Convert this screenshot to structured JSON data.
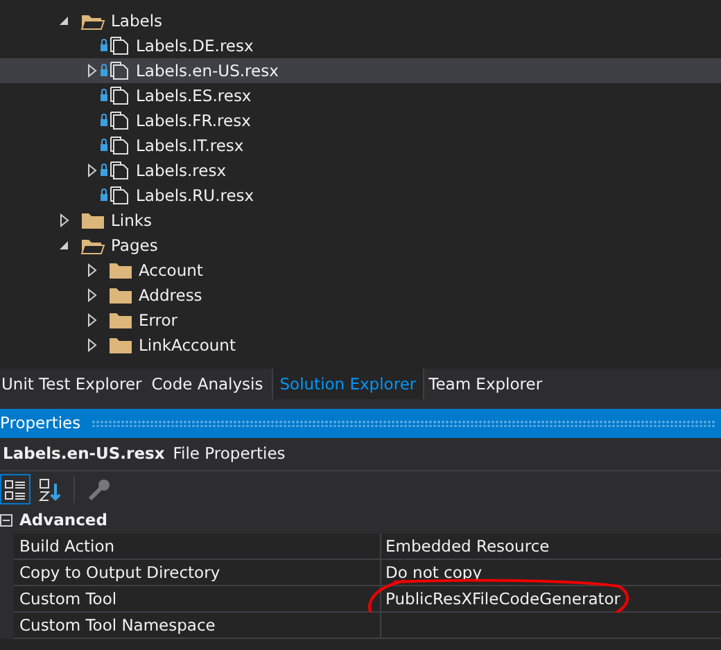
{
  "solution_tree": [
    {
      "label": "Labels",
      "kind": "folder",
      "expanded": true,
      "selected": false,
      "children": [
        {
          "label": "Labels.DE.resx",
          "kind": "file",
          "selected": false
        },
        {
          "label": "Labels.en-US.resx",
          "kind": "file",
          "expanded": false,
          "selected": true
        },
        {
          "label": "Labels.ES.resx",
          "kind": "file",
          "selected": false
        },
        {
          "label": "Labels.FR.resx",
          "kind": "file",
          "selected": false
        },
        {
          "label": "Labels.IT.resx",
          "kind": "file",
          "selected": false
        },
        {
          "label": "Labels.resx",
          "kind": "file",
          "expanded": false,
          "selected": false
        },
        {
          "label": "Labels.RU.resx",
          "kind": "file",
          "selected": false
        }
      ]
    },
    {
      "label": "Links",
      "kind": "folder",
      "expanded": false,
      "selected": false
    },
    {
      "label": "Pages",
      "kind": "folder",
      "expanded": true,
      "selected": false,
      "children": [
        {
          "label": "Account",
          "kind": "folder",
          "expanded": false,
          "selected": false
        },
        {
          "label": "Address",
          "kind": "folder",
          "expanded": false,
          "selected": false
        },
        {
          "label": "Error",
          "kind": "folder",
          "expanded": false,
          "selected": false
        },
        {
          "label": "LinkAccount",
          "kind": "folder",
          "expanded": false,
          "selected": false
        }
      ]
    }
  ],
  "tabs": [
    {
      "label": "Unit Test Explorer",
      "selected": false
    },
    {
      "label": "Code Analysis",
      "selected": false
    },
    {
      "label": "Solution Explorer",
      "selected": true
    },
    {
      "label": "Team Explorer",
      "selected": false
    }
  ],
  "properties": {
    "title": "Properties",
    "object_name": "Labels.en-US.resx",
    "object_type": "File Properties",
    "toolbar": [
      {
        "kind": "categorized",
        "selected": true
      },
      {
        "kind": "alphabetical",
        "selected": false
      },
      {
        "kind": "property-pages",
        "selected": false
      }
    ],
    "category": "Advanced",
    "rows": [
      {
        "name": "Build Action",
        "value": "Embedded Resource"
      },
      {
        "name": "Copy to Output Directory",
        "value": "Do not copy"
      },
      {
        "name": "Custom Tool",
        "value": "PublicResXFileCodeGenerator",
        "circled": true
      },
      {
        "name": "Custom Tool Namespace"
      }
    ]
  }
}
